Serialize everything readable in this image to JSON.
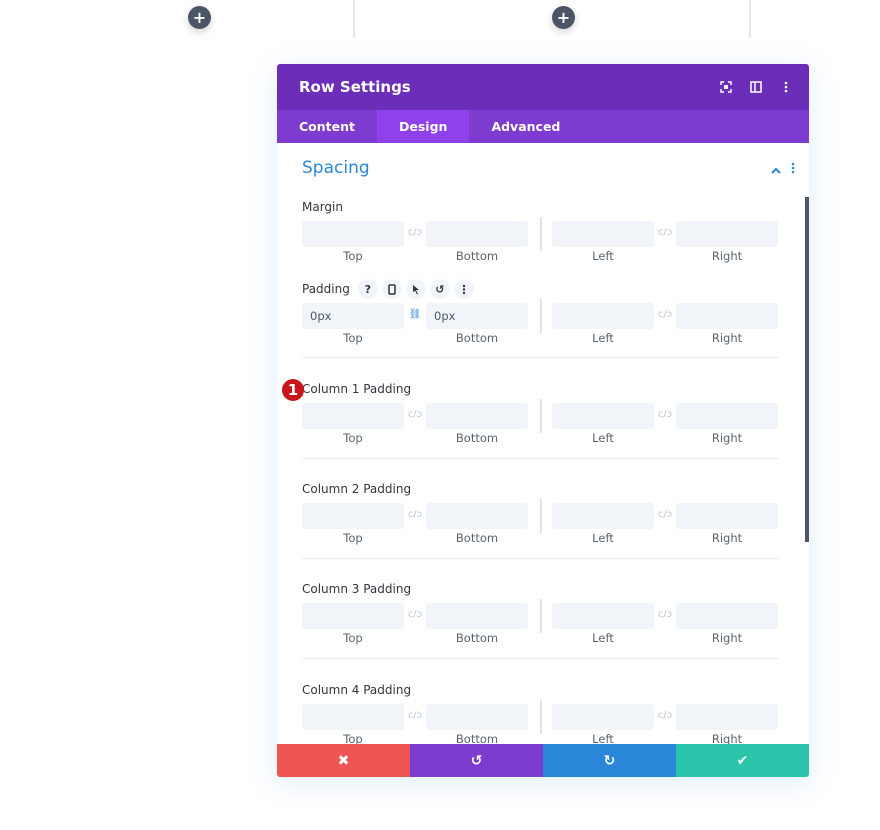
{
  "canvas": {
    "add_buttons": [
      {
        "label": "+"
      },
      {
        "label": "+"
      }
    ]
  },
  "modal": {
    "title": "Row Settings",
    "header_icons": [
      "expand-icon",
      "sidebar-layout-icon",
      "more-options-icon"
    ],
    "tabs": [
      {
        "label": "Content",
        "active": false
      },
      {
        "label": "Design",
        "active": true
      },
      {
        "label": "Advanced",
        "active": false
      }
    ],
    "section": {
      "title": "Spacing",
      "groups": [
        {
          "label": "Margin",
          "values": [
            "",
            "",
            "",
            ""
          ],
          "linked": false
        },
        {
          "label": "Padding",
          "values": [
            "0px",
            "0px",
            "",
            ""
          ],
          "linked": true,
          "annotation": "1",
          "tools": [
            "?",
            "mobile-icon",
            "cursor-icon",
            "reset-icon",
            "more-icon"
          ]
        },
        {
          "label": "Column 1 Padding",
          "values": [
            "",
            "",
            "",
            ""
          ],
          "linked": false
        },
        {
          "label": "Column 2 Padding",
          "values": [
            "",
            "",
            "",
            ""
          ],
          "linked": false
        },
        {
          "label": "Column 3 Padding",
          "values": [
            "",
            "",
            "",
            ""
          ],
          "linked": false
        },
        {
          "label": "Column 4 Padding",
          "values": [
            "",
            "",
            "",
            ""
          ],
          "linked": false
        }
      ],
      "sublabels": [
        "Top",
        "Bottom",
        "Left",
        "Right"
      ]
    },
    "footer": {
      "cancel": "✖",
      "undo": "↺",
      "redo": "↻",
      "save": "✔",
      "colors": {
        "cancel": "#ef5555",
        "undo": "#7e3bd0",
        "redo": "#2b87da",
        "save": "#29c4a9"
      }
    }
  }
}
